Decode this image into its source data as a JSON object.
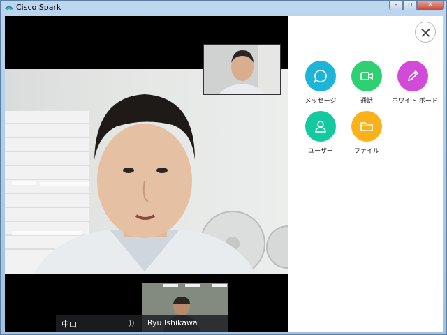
{
  "window": {
    "title": "Cisco Spark"
  },
  "participants": {
    "left_name": "中山",
    "right_name": "Ryu Ishikawa"
  },
  "actions": [
    {
      "label": "メッセージ",
      "icon": "message-icon",
      "color": "#1eb4d8"
    },
    {
      "label": "通話",
      "icon": "video-icon",
      "color": "#2fd071"
    },
    {
      "label": "ホワイト ボード",
      "icon": "pencil-icon",
      "color": "#d24bd8"
    },
    {
      "label": "ユーザー",
      "icon": "user-icon",
      "color": "#14c9a0"
    },
    {
      "label": "ファイル",
      "icon": "folder-icon",
      "color": "#fbb21a"
    }
  ],
  "colors": {
    "panel_bg": "#ffffff",
    "video_bg": "#000000"
  }
}
